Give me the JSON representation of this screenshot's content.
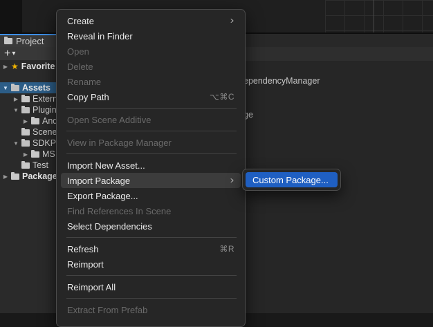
{
  "project_panel": {
    "tab_label": "Project",
    "add_button": "+",
    "add_dropdown": "▾",
    "tree": [
      {
        "label": "Favorite",
        "icon": "star-icon",
        "expand": "▶"
      },
      {
        "label": "Assets",
        "icon": "folder-open-icon",
        "expand": "▼"
      },
      {
        "label": "Extern",
        "icon": "folder-icon",
        "expand": "▶"
      },
      {
        "label": "Plugin",
        "icon": "folder-open-icon",
        "expand": "▼"
      },
      {
        "label": "And",
        "icon": "folder-icon",
        "expand": "▶"
      },
      {
        "label": "Scene",
        "icon": "folder-icon",
        "expand": ""
      },
      {
        "label": "SDKP",
        "icon": "folder-open-icon",
        "expand": "▼"
      },
      {
        "label": "MS",
        "icon": "folder-icon",
        "expand": "▶"
      },
      {
        "label": "Test",
        "icon": "folder-icon",
        "expand": ""
      },
      {
        "label": "Package",
        "icon": "folder-icon",
        "expand": "▶"
      }
    ]
  },
  "right_content": {
    "line1": "ependencyManager",
    "line2": "ge"
  },
  "context_menu": {
    "items": [
      {
        "label": "Create",
        "shortcut": "",
        "arrow": ">",
        "enabled": true
      },
      {
        "label": "Reveal in Finder",
        "shortcut": "",
        "arrow": "",
        "enabled": true
      },
      {
        "label": "Open",
        "shortcut": "",
        "arrow": "",
        "enabled": false
      },
      {
        "label": "Delete",
        "shortcut": "",
        "arrow": "",
        "enabled": false
      },
      {
        "label": "Rename",
        "shortcut": "",
        "arrow": "",
        "enabled": false
      },
      {
        "label": "Copy Path",
        "shortcut": "⌥⌘C",
        "arrow": "",
        "enabled": true
      },
      {
        "label": "Open Scene Additive",
        "shortcut": "",
        "arrow": "",
        "enabled": false
      },
      {
        "label": "View in Package Manager",
        "shortcut": "",
        "arrow": "",
        "enabled": false
      },
      {
        "label": "Import New Asset...",
        "shortcut": "",
        "arrow": "",
        "enabled": true
      },
      {
        "label": "Import Package",
        "shortcut": "",
        "arrow": ">",
        "enabled": true
      },
      {
        "label": "Export Package...",
        "shortcut": "",
        "arrow": "",
        "enabled": true
      },
      {
        "label": "Find References In Scene",
        "shortcut": "",
        "arrow": "",
        "enabled": false
      },
      {
        "label": "Select Dependencies",
        "shortcut": "",
        "arrow": "",
        "enabled": true
      },
      {
        "label": "Refresh",
        "shortcut": "⌘R",
        "arrow": "",
        "enabled": true
      },
      {
        "label": "Reimport",
        "shortcut": "",
        "arrow": "",
        "enabled": true
      },
      {
        "label": "Reimport All",
        "shortcut": "",
        "arrow": "",
        "enabled": true
      },
      {
        "label": "Extract From Prefab",
        "shortcut": "",
        "arrow": "",
        "enabled": false
      }
    ]
  },
  "submenu": {
    "items": [
      {
        "label": "Custom Package..."
      }
    ]
  },
  "colors": {
    "selection": "#2c5d87",
    "submenu_highlight": "#1f5fc2",
    "tab_accent": "#3d8fe8"
  }
}
